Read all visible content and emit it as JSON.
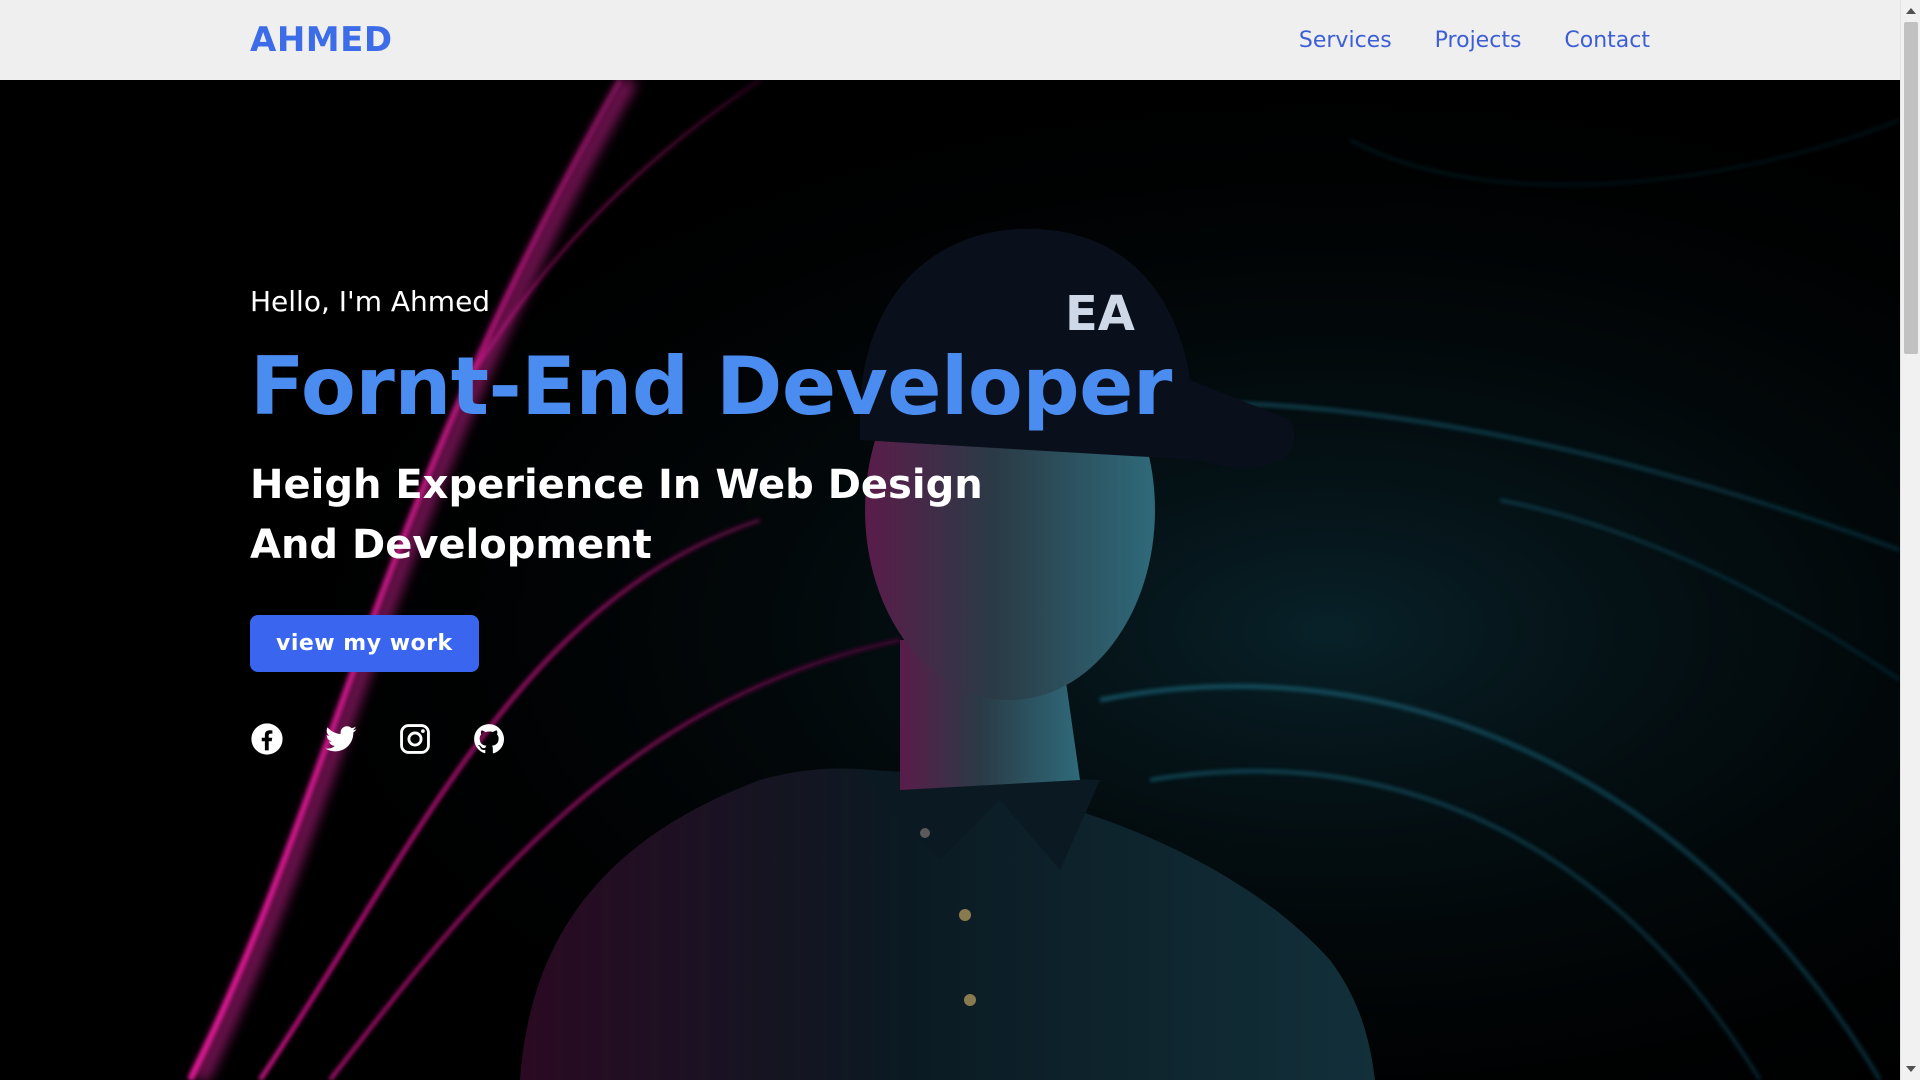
{
  "navbar": {
    "logo": "AHMED",
    "links": [
      {
        "label": "Services"
      },
      {
        "label": "Projects"
      },
      {
        "label": "Contact"
      }
    ]
  },
  "hero": {
    "greeting": "Hello, I'm Ahmed",
    "headline": "Fornt-End Developer",
    "subheadline_line1": "Heigh Experience In Web Design",
    "subheadline_line2": "And Development",
    "cta_label": "view my work",
    "social": [
      {
        "icon": "facebook-icon"
      },
      {
        "icon": "twitter-icon"
      },
      {
        "icon": "instagram-icon"
      },
      {
        "icon": "github-icon"
      }
    ]
  },
  "colors": {
    "brand_blue": "#3d6ce8",
    "headline_blue": "#4a8cf0",
    "button_blue": "#3a66ef",
    "navbar_bg": "#efefef",
    "hero_bg": "#000000",
    "accent_magenta": "#e0189a",
    "accent_teal": "#1f6f86"
  }
}
